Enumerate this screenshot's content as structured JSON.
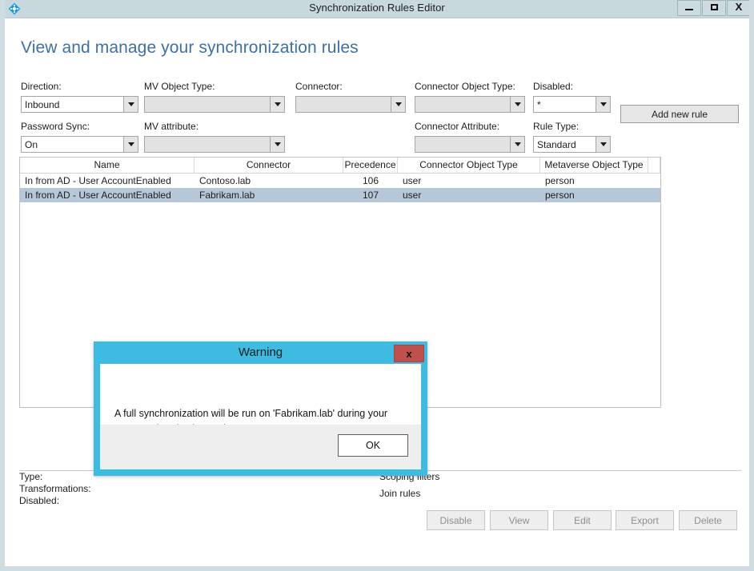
{
  "window": {
    "title": "Synchronization Rules Editor",
    "icon": "azure-ad-connect-icon",
    "minimize_label": "–",
    "maximize_label": "□",
    "close_label": "X"
  },
  "heading": "View and manage your synchronization rules",
  "filters": {
    "direction": {
      "label": "Direction:",
      "value": "Inbound"
    },
    "mv_object_type": {
      "label": "MV Object Type:",
      "value": ""
    },
    "connector": {
      "label": "Connector:",
      "value": ""
    },
    "connector_object_type": {
      "label": "Connector Object Type:",
      "value": ""
    },
    "disabled": {
      "label": "Disabled:",
      "value": "*"
    },
    "password_sync": {
      "label": "Password Sync:",
      "value": "On"
    },
    "mv_attribute": {
      "label": "MV attribute:",
      "value": ""
    },
    "connector_attribute": {
      "label": "Connector Attribute:",
      "value": ""
    },
    "rule_type": {
      "label": "Rule Type:",
      "value": "Standard"
    }
  },
  "add_new_rule_button": "Add new rule",
  "grid": {
    "columns": [
      "Name",
      "Connector",
      "Precedence",
      "Connector Object Type",
      "Metaverse Object Type"
    ],
    "rows": [
      {
        "name": "In from AD - User AccountEnabled",
        "connector": "Contoso.lab",
        "precedence": "106",
        "connector_object_type": "user",
        "metaverse_object_type": "person",
        "selected": false
      },
      {
        "name": "In from AD - User AccountEnabled",
        "connector": "Fabrikam.lab",
        "precedence": "107",
        "connector_object_type": "user",
        "metaverse_object_type": "person",
        "selected": true
      }
    ]
  },
  "details": {
    "type_label": "Type:",
    "transformations_label": "Transformations:",
    "disabled_label": "Disabled:",
    "scoping_filters_label": "Scoping filters",
    "join_rules_label": "Join rules"
  },
  "actions": {
    "disable": "Disable",
    "view": "View",
    "edit": "Edit",
    "export": "Export",
    "delete": "Delete"
  },
  "dialog": {
    "title": "Warning",
    "close_label": "x",
    "message": "A full synchronization will be run on 'Fabrikam.lab' during your next synchronization cycle.",
    "ok_label": "OK"
  },
  "colors": {
    "titlebar": "#c8d9de",
    "heading": "#3f6fa8",
    "dialog_chrome": "#3dbbe0",
    "dialog_close": "#c0504d",
    "row_selected": "#b6c7d9"
  }
}
